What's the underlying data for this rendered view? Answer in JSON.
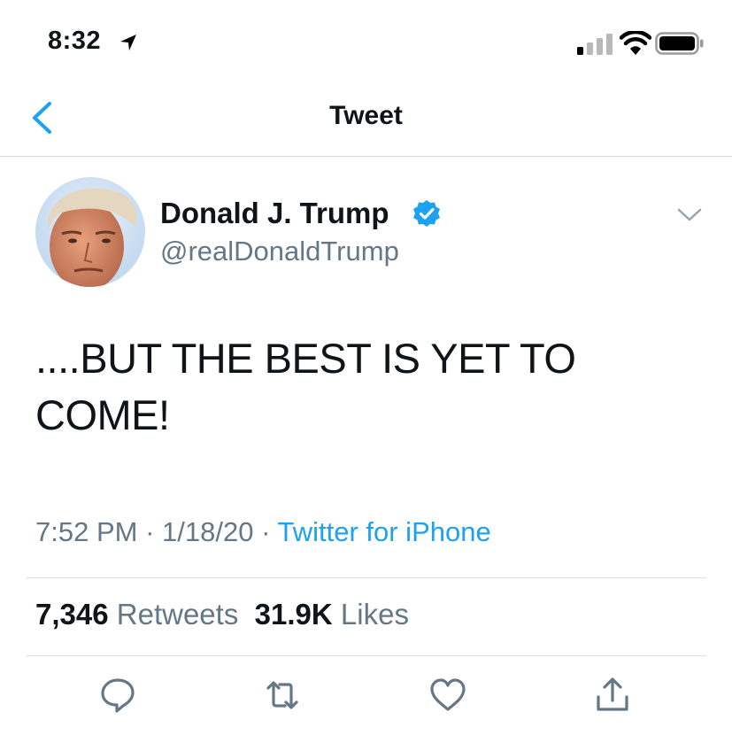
{
  "status_bar": {
    "time": "8:32"
  },
  "nav": {
    "title": "Tweet"
  },
  "tweet": {
    "author_name": "Donald J. Trump",
    "author_handle": "@realDonaldTrump",
    "text": "....BUT THE BEST IS YET TO COME!",
    "time": "7:52 PM",
    "date": "1/18/20",
    "separator": "·",
    "source": "Twitter for iPhone",
    "retweet_count": "7,346",
    "retweet_label": "Retweets",
    "like_count": "31.9K",
    "like_label": "Likes"
  },
  "icons": [
    "location-arrow-icon",
    "signal-icon",
    "wifi-icon",
    "battery-icon",
    "back-chevron-icon",
    "verified-badge-icon",
    "chevron-down-icon",
    "reply-icon",
    "retweet-icon",
    "like-icon",
    "share-icon"
  ],
  "colors": {
    "accent": "#1da1f2",
    "secondary_text": "#657786",
    "divider": "#d9dfe3"
  }
}
